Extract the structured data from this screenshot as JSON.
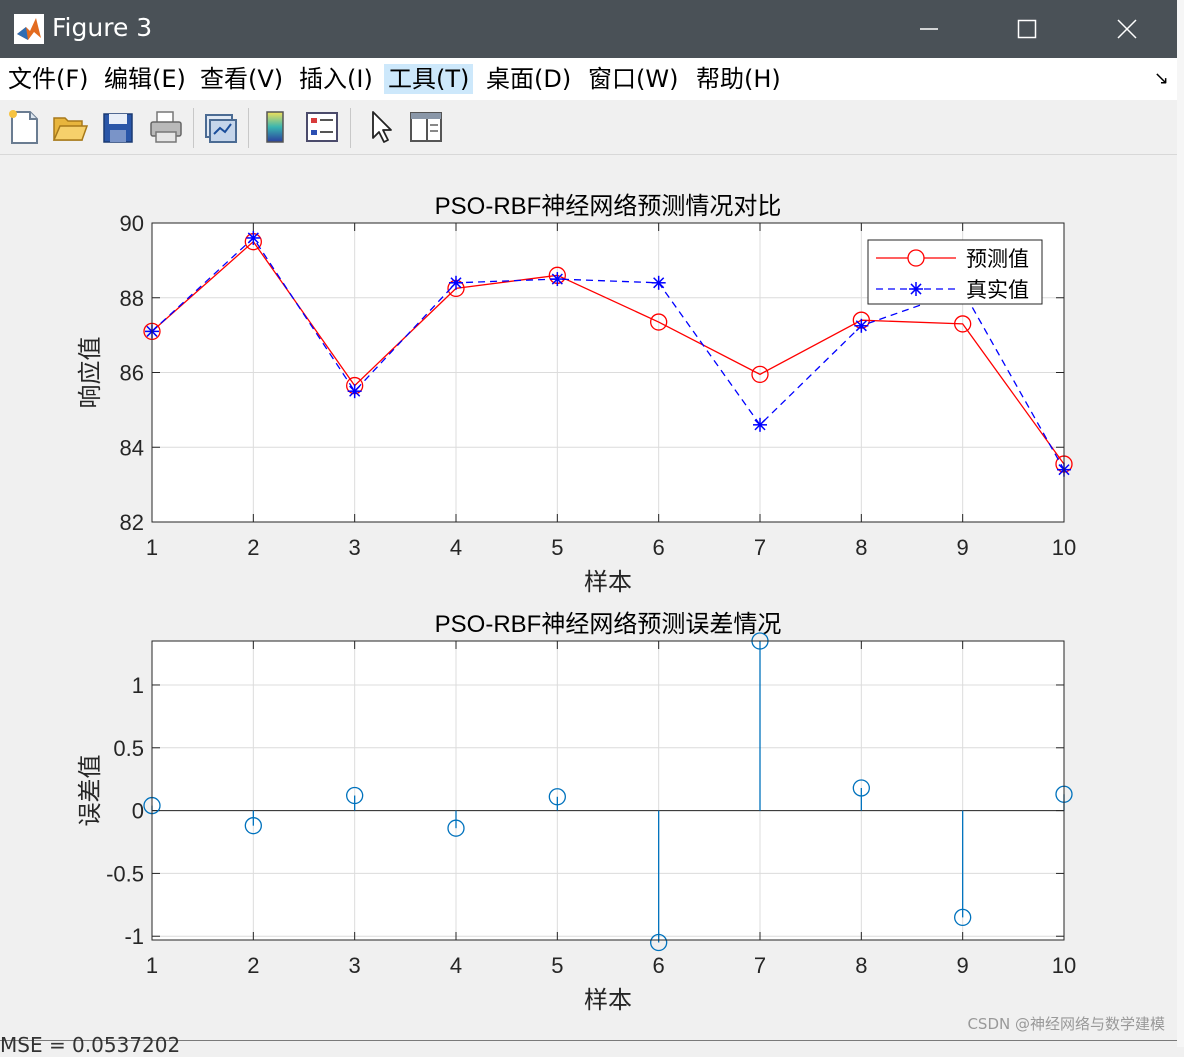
{
  "window": {
    "title": "Figure 3",
    "buttons": {
      "minimize": "minimize-icon",
      "maximize": "maximize-icon",
      "close": "close-icon"
    }
  },
  "menubar": {
    "items": [
      "文件(F)",
      "编辑(E)",
      "查看(V)",
      "插入(I)",
      "工具(T)",
      "桌面(D)",
      "窗口(W)",
      "帮助(H)"
    ],
    "active_index": 4,
    "dock_arrow": "↘"
  },
  "toolbar": {
    "icons": [
      "new-figure-icon",
      "open-file-icon",
      "save-icon",
      "print-icon",
      "link-plot-icon",
      "colorbar-icon",
      "legend-icon",
      "pointer-icon",
      "property-editor-icon"
    ]
  },
  "colors": {
    "predicted": "#ff0000",
    "actual": "#0000ff",
    "error": "#0072bd",
    "grid": "#dcdcdc"
  },
  "chart_data": [
    {
      "type": "line",
      "title": "PSO-RBF神经网络预测情况对比",
      "xlabel": "样本",
      "ylabel": "响应值",
      "x": [
        1,
        2,
        3,
        4,
        5,
        6,
        7,
        8,
        9,
        10
      ],
      "xlim": [
        1,
        10
      ],
      "ylim": [
        82,
        90
      ],
      "xticks": [
        "1",
        "2",
        "3",
        "4",
        "5",
        "6",
        "7",
        "8",
        "9",
        "10"
      ],
      "yticks": [
        "82",
        "84",
        "86",
        "88",
        "90"
      ],
      "grid": true,
      "legend_position": "top-right",
      "series": [
        {
          "name": "预测值",
          "marker": "circle",
          "line": "solid",
          "color": "#ff0000",
          "values": [
            87.1,
            89.5,
            85.65,
            88.25,
            88.6,
            87.35,
            85.95,
            87.4,
            87.3,
            83.55
          ]
        },
        {
          "name": "真实值",
          "marker": "asterisk",
          "line": "dashed",
          "color": "#0000ff",
          "values": [
            87.1,
            89.6,
            85.5,
            88.4,
            88.5,
            88.4,
            84.6,
            87.25,
            88.2,
            83.4
          ]
        }
      ]
    },
    {
      "type": "stem",
      "title": "PSO-RBF神经网络预测误差情况",
      "xlabel": "样本",
      "ylabel": "误差值",
      "x": [
        1,
        2,
        3,
        4,
        5,
        6,
        7,
        8,
        9,
        10
      ],
      "xlim": [
        1,
        10
      ],
      "ylim": [
        -1.03,
        1.35
      ],
      "xticks": [
        "1",
        "2",
        "3",
        "4",
        "5",
        "6",
        "7",
        "8",
        "9",
        "10"
      ],
      "yticks": [
        "-1",
        "-0.5",
        "0",
        "0.5",
        "1"
      ],
      "grid": true,
      "series": [
        {
          "color": "#0072bd",
          "values": [
            0.04,
            -0.12,
            0.12,
            -0.14,
            0.11,
            -1.05,
            1.35,
            0.18,
            -0.85,
            0.13
          ]
        }
      ]
    }
  ],
  "watermark": "CSDN @神经网络与数学建模",
  "clipped_text": "MSE = 0.0537202"
}
